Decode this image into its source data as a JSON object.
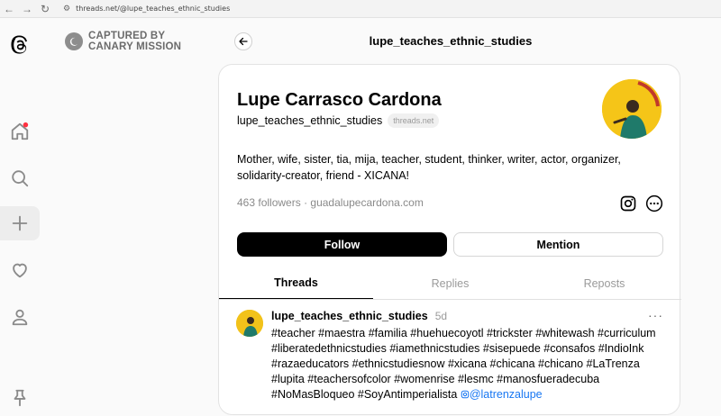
{
  "browser": {
    "url": "threads.net/@lupe_teaches_ethnic_studies"
  },
  "watermark": {
    "line1": "CAPTURED BY",
    "line2": "CANARY MISSION"
  },
  "header": {
    "title": "lupe_teaches_ethnic_studies"
  },
  "profile": {
    "name": "Lupe Carrasco Cardona",
    "handle": "lupe_teaches_ethnic_studies",
    "domain_badge": "threads.net",
    "bio": "Mother, wife, sister, tia, mija, teacher, student, thinker, writer, actor, organizer, solidarity-creator, friend - XICANA!",
    "followers": "463 followers",
    "separator": "·",
    "website": "guadalupecardona.com",
    "follow_label": "Follow",
    "mention_label": "Mention"
  },
  "tabs": [
    {
      "label": "Threads",
      "active": true
    },
    {
      "label": "Replies",
      "active": false
    },
    {
      "label": "Reposts",
      "active": false
    }
  ],
  "post": {
    "user": "lupe_teaches_ethnic_studies",
    "time": "5d",
    "text": "#teacher #maestra #familia #huehuecoyotl #trickster #whitewash #curriculum #liberatedethnicstudies #iamethnicstudies #sisepuede #consafos #IndioInk #razaeducators #ethnicstudiesnow #xicana #chicana #chicano #LaTrenza #lupita #teachersofcolor #womenrise #lesmc #manosfueradecuba #NoMasBloqueo #SoyAntimperialista ",
    "mention": "@latrenzalupe"
  },
  "icons": {
    "sidebar": [
      "threads-logo-icon",
      "home-icon",
      "search-icon",
      "plus-icon",
      "heart-icon",
      "profile-icon",
      "pin-icon"
    ],
    "accent_notification": "#ff3040"
  },
  "colors": {
    "avatar_yellow": "#f5c518",
    "mention_blue": "#1877f2"
  }
}
